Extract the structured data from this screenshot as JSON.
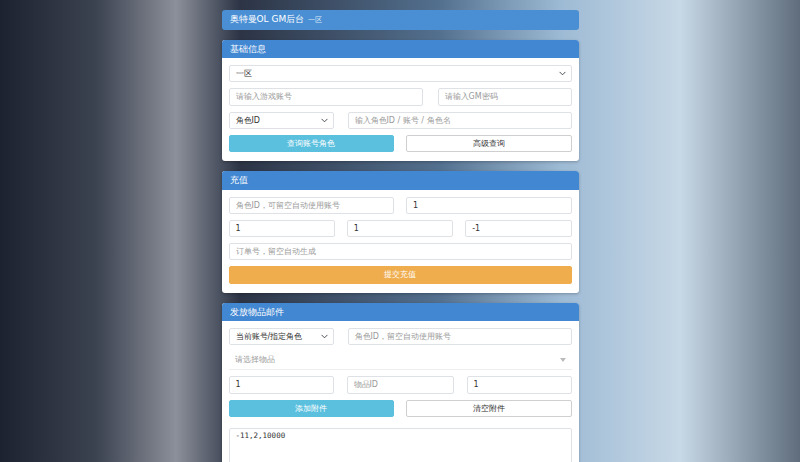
{
  "header": {
    "title": "奥特曼OL GM后台",
    "subtitle": "一区"
  },
  "basic": {
    "title": "基础信息",
    "server": "一区",
    "account_placeholder": "请输入游戏账号",
    "password_placeholder": "请输入GM密码",
    "query_type": "角色ID",
    "query_placeholder": "输入角色ID / 账号 / 角色名",
    "buttons": [
      {
        "label": "查询账号角色",
        "kind": "info"
      },
      {
        "label": "高级查询",
        "kind": "outline"
      }
    ]
  },
  "recharge": {
    "title": "充值",
    "role_placeholder": "角色ID，可留空自动使用账号",
    "amount": "1",
    "params": [
      "1",
      "1",
      "-1"
    ],
    "order_placeholder": "订单号，留空自动生成",
    "submit": "提交充值"
  },
  "mail": {
    "title": "发放物品邮件",
    "target": "当前账号/指定角色",
    "role_placeholder": "角色ID，留空自动使用账号",
    "item_select": "请选择物品",
    "quantity": "1",
    "item_id_placeholder": "物品ID",
    "count": "1",
    "buttons": [
      {
        "label": "添加附件",
        "kind": "info"
      },
      {
        "label": "清空附件",
        "kind": "outline"
      }
    ],
    "attachments": "-11,2,10000"
  }
}
